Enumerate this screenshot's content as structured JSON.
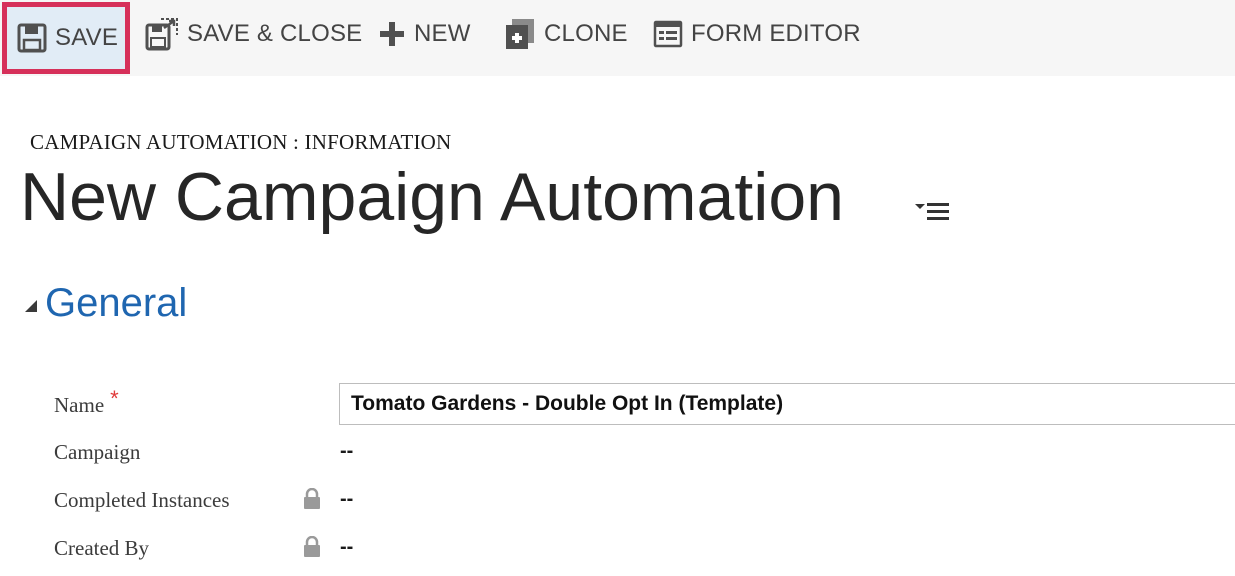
{
  "toolbar": {
    "save_label": "SAVE",
    "save_close_label": "SAVE & CLOSE",
    "new_label": "NEW",
    "clone_label": "CLONE",
    "form_editor_label": "FORM EDITOR",
    "highlight_color": "#d6305a"
  },
  "header": {
    "breadcrumb": "CAMPAIGN AUTOMATION : INFORMATION",
    "title": "New Campaign Automation"
  },
  "section": {
    "title": "General",
    "accent_color": "#1f66b0"
  },
  "fields": {
    "name": {
      "label": "Name",
      "required_marker": "*",
      "value": "Tomato Gardens - Double Opt In (Template)"
    },
    "campaign": {
      "label": "Campaign",
      "value": "--"
    },
    "completed_instances": {
      "label": "Completed Instances",
      "value": "--",
      "locked": true
    },
    "created_by": {
      "label": "Created By",
      "value": "--",
      "locked": true
    }
  }
}
